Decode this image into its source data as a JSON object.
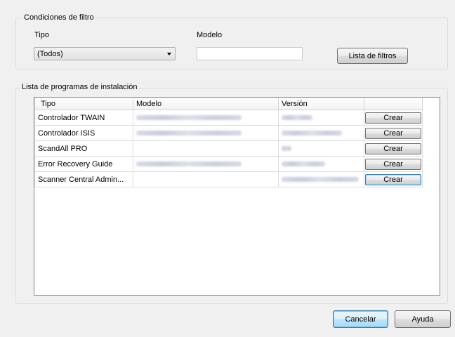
{
  "filter_group": {
    "legend": "Condiciones de filtro",
    "type_label": "Tipo",
    "type_selected": "(Todos)",
    "model_label": "Modelo",
    "model_value": "",
    "filter_list_button": "Lista de filtros"
  },
  "install_group": {
    "legend": "Lista de programas de instalación",
    "columns": [
      "Tipo",
      "Modelo",
      "Versión",
      ""
    ],
    "rows": [
      {
        "type": "Controlador TWAIN",
        "model_redacted": true,
        "version_redacted": true,
        "action": "Crear"
      },
      {
        "type": "Controlador ISIS",
        "model_redacted": true,
        "version_redacted": true,
        "action": "Crear"
      },
      {
        "type": "ScandAll PRO",
        "model_redacted": false,
        "version_redacted": true,
        "action": "Crear"
      },
      {
        "type": "Error Recovery Guide",
        "model_redacted": true,
        "version_redacted": true,
        "action": "Crear"
      },
      {
        "type": "Scanner Central Admin...",
        "model_redacted": false,
        "version_redacted": true,
        "action": "Crear"
      }
    ]
  },
  "footer": {
    "cancel_label": "Cancelar",
    "help_label": "Ayuda"
  }
}
